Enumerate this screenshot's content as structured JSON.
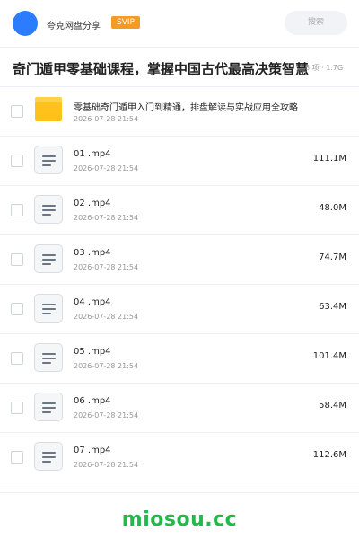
{
  "header": {
    "username": "夸克网盘分享",
    "vip_badge": "SVIP",
    "search_placeholder": "搜索"
  },
  "share": {
    "title": "奇门遁甲零基础课程，掌握中国古代最高决策智慧",
    "meta": "8 项 · 1.7G"
  },
  "files": [
    {
      "type": "folder",
      "name": "零基础奇门遁甲入门到精通，排盘解读与实战应用全攻略",
      "date": "2026-07-28 21:54",
      "size": ""
    },
    {
      "type": "file",
      "name": "01 .mp4",
      "date": "2026-07-28 21:54",
      "size": "111.1M"
    },
    {
      "type": "file",
      "name": "02 .mp4",
      "date": "2026-07-28 21:54",
      "size": "48.0M"
    },
    {
      "type": "file",
      "name": "03 .mp4",
      "date": "2026-07-28 21:54",
      "size": "74.7M"
    },
    {
      "type": "file",
      "name": "04 .mp4",
      "date": "2026-07-28 21:54",
      "size": "63.4M"
    },
    {
      "type": "file",
      "name": "05 .mp4",
      "date": "2026-07-28 21:54",
      "size": "101.4M"
    },
    {
      "type": "file",
      "name": "06 .mp4",
      "date": "2026-07-28 21:54",
      "size": "58.4M"
    },
    {
      "type": "file",
      "name": "07 .mp4",
      "date": "2026-07-28 21:54",
      "size": "112.6M"
    }
  ],
  "footer": {
    "watermark": "miosou.cc"
  },
  "colors": {
    "accent": "#2b7cff",
    "vip": "#f59a23",
    "folder": "#ffc21a",
    "watermark": "#22b84a"
  },
  "icons": {
    "folder": "folder-icon",
    "file": "file-doc-icon"
  }
}
